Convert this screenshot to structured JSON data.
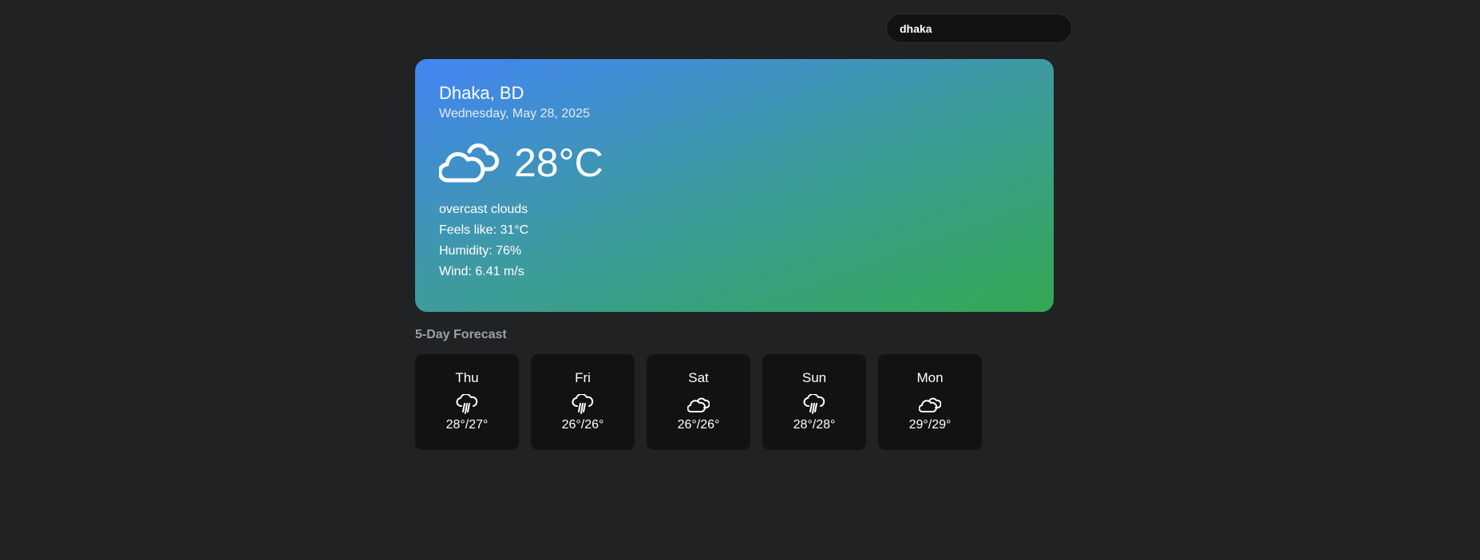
{
  "search": {
    "value": "dhaka"
  },
  "current": {
    "location": "Dhaka, BD",
    "date": "Wednesday, May 28, 2025",
    "icon": "clouds-icon",
    "temperature": "28°C",
    "description": "overcast clouds",
    "feels_like": "Feels like: 31°C",
    "humidity": "Humidity: 76%",
    "wind": "Wind: 6.41 m/s",
    "gradient": [
      "#4285f4",
      "#34a853"
    ]
  },
  "forecast": {
    "title": "5-Day Forecast",
    "days": [
      {
        "day": "Thu",
        "icon": "rain-icon",
        "temps": "28°/27°"
      },
      {
        "day": "Fri",
        "icon": "rain-icon",
        "temps": "26°/26°"
      },
      {
        "day": "Sat",
        "icon": "clouds-icon",
        "temps": "26°/26°"
      },
      {
        "day": "Sun",
        "icon": "rain-icon",
        "temps": "28°/28°"
      },
      {
        "day": "Mon",
        "icon": "clouds-icon",
        "temps": "29°/29°"
      }
    ]
  },
  "colors": {
    "background": "#212224",
    "card": "#121212",
    "muted_text": "#9aa0a6"
  }
}
